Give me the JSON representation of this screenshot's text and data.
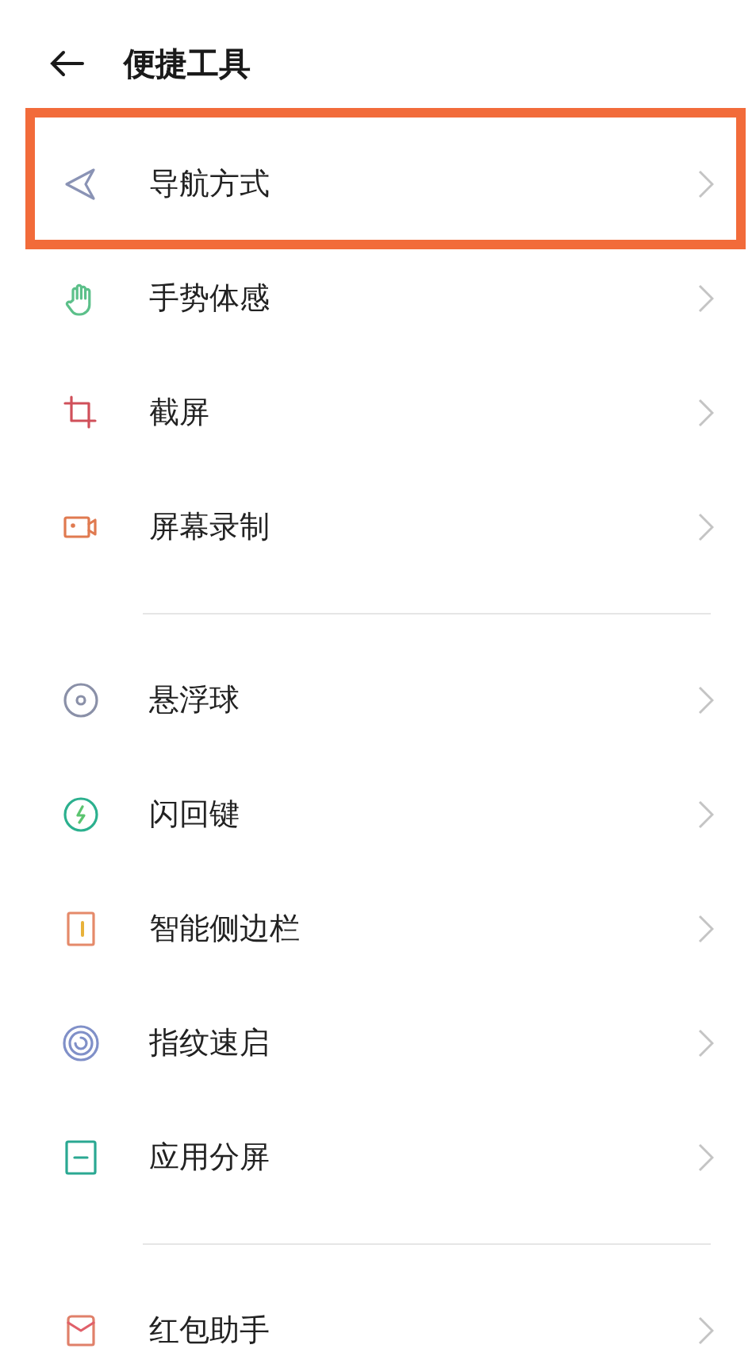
{
  "header": {
    "title": "便捷工具"
  },
  "groups": [
    {
      "items": [
        {
          "label": "导航方式",
          "highlighted": true
        },
        {
          "label": "手势体感",
          "highlighted": false
        },
        {
          "label": "截屏",
          "highlighted": false
        },
        {
          "label": "屏幕录制",
          "highlighted": false
        }
      ]
    },
    {
      "items": [
        {
          "label": "悬浮球",
          "highlighted": false
        },
        {
          "label": "闪回键",
          "highlighted": false
        },
        {
          "label": "智能侧边栏",
          "highlighted": false
        },
        {
          "label": "指纹速启",
          "highlighted": false
        },
        {
          "label": "应用分屏",
          "highlighted": false
        }
      ]
    },
    {
      "items": [
        {
          "label": "红包助手",
          "highlighted": false
        }
      ]
    }
  ]
}
